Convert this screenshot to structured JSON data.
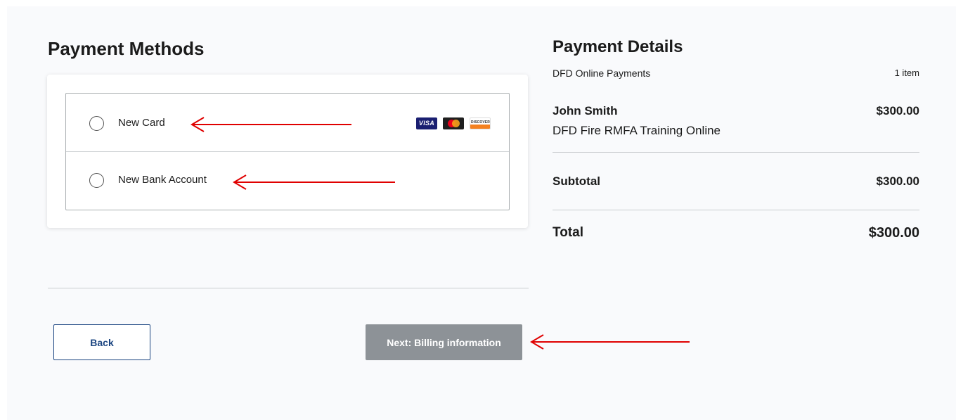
{
  "payment_methods": {
    "title": "Payment Methods",
    "options": [
      {
        "label": "New Card",
        "selected": false,
        "card_logos": [
          "visa-icon",
          "mastercard-icon",
          "discover-icon"
        ]
      },
      {
        "label": "New Bank Account",
        "selected": false
      }
    ],
    "card_logo_text": {
      "visa": "VISA",
      "discover": "DISCOVER"
    }
  },
  "actions": {
    "back_label": "Back",
    "next_label": "Next: Billing information",
    "next_button_color": "#8d9297",
    "back_button_color": "#1a4480"
  },
  "payment_details": {
    "title": "Payment Details",
    "subtitle": "DFD Online Payments",
    "item_count": "1 item",
    "line_item": {
      "name": "John Smith",
      "description": "DFD Fire RMFA Training Online",
      "amount": "$300.00"
    },
    "subtotal_label": "Subtotal",
    "subtotal_value": "$300.00",
    "total_label": "Total",
    "total_value": "$300.00"
  },
  "annotations": {
    "arrow_color": "#e00000"
  }
}
